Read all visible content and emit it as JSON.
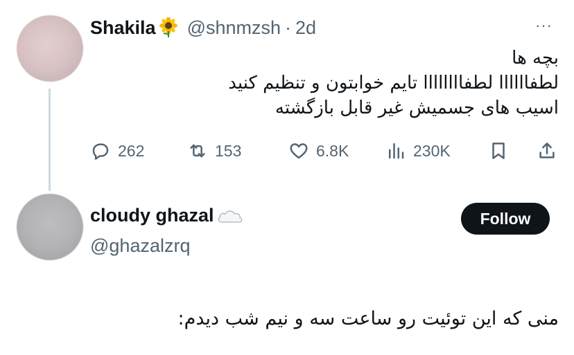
{
  "tweet1": {
    "name": "Shakila",
    "name_emoji": "sunflower-icon",
    "handle": "@shnmzsh",
    "separator": "·",
    "time": "2d",
    "more_label": "···",
    "lines": [
      "بچه ها",
      "لطفاااااا لطفاااااااا تایم خوابتون و تنظیم کنید",
      "اسیب های جسمیش غیر قابل بازگشته"
    ],
    "actions": {
      "replies": "262",
      "reposts": "153",
      "likes": "6.8K",
      "views": "230K"
    }
  },
  "tweet2": {
    "name": "cloudy ghazal",
    "name_emoji": "cloud-icon",
    "handle": "@ghazalzrq",
    "follow_label": "Follow",
    "text": "منی که این توئیت رو ساعت سه و نیم شب دیدم:"
  },
  "colors": {
    "text_primary": "#0f1419",
    "text_secondary": "#536471",
    "thread_line": "#cfd9de",
    "follow_bg": "#0f1419",
    "follow_text": "#ffffff"
  }
}
